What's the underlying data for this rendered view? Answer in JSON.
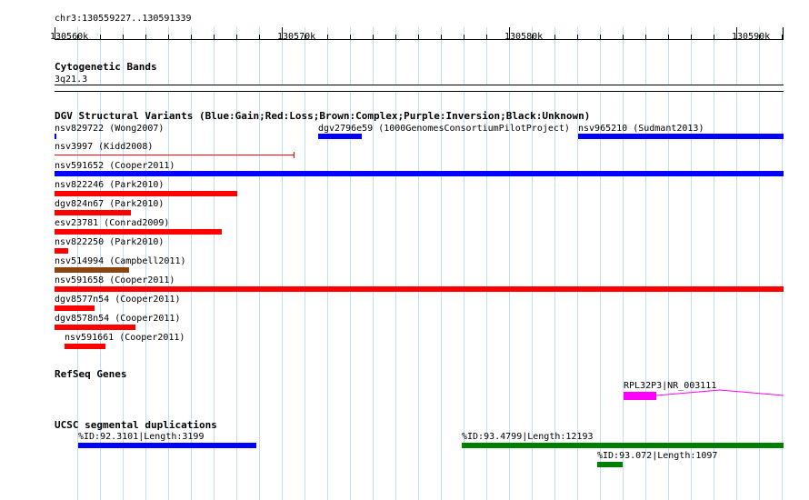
{
  "locus": "chr3:130559227..130591339",
  "ruler": {
    "labels": [
      "130560k",
      "130570k",
      "130580k",
      "130590k"
    ]
  },
  "tracks": {
    "cyto": {
      "title": "Cytogenetic Bands",
      "band": "3q21.3"
    },
    "dgv": {
      "title": "DGV Structural Variants (Blue:Gain;Red:Loss;Brown:Complex;Purple:Inversion;Black:Unknown)",
      "features": [
        {
          "label": "nsv829722 (Wong2007)",
          "type": "Gain",
          "color": "#0000ff"
        },
        {
          "label": "dgv2796e59 (1000GenomesConsortiumPilotProject)",
          "type": "Gain",
          "color": "#0000ff"
        },
        {
          "label": "nsv965210 (Sudmant2013)",
          "type": "Gain",
          "color": "#0000ff"
        },
        {
          "label": "nsv3997 (Kidd2008)",
          "type": "Loss",
          "color": "#ff0000"
        },
        {
          "label": "nsv591652 (Cooper2011)",
          "type": "Gain",
          "color": "#0000ff"
        },
        {
          "label": "nsv822246 (Park2010)",
          "type": "Loss",
          "color": "#ff0000"
        },
        {
          "label": "dgv824n67 (Park2010)",
          "type": "Loss",
          "color": "#ff0000"
        },
        {
          "label": "esv23781 (Conrad2009)",
          "type": "Loss",
          "color": "#ff0000"
        },
        {
          "label": "nsv822250 (Park2010)",
          "type": "Loss",
          "color": "#ff0000"
        },
        {
          "label": "nsv514994 (Campbell2011)",
          "type": "Complex",
          "color": "#8b4513"
        },
        {
          "label": "nsv591658 (Cooper2011)",
          "type": "Loss",
          "color": "#ff0000"
        },
        {
          "label": "dgv8577n54 (Cooper2011)",
          "type": "Loss",
          "color": "#ff0000"
        },
        {
          "label": "dgv8578n54 (Cooper2011)",
          "type": "Loss",
          "color": "#ff0000"
        },
        {
          "label": "nsv591661 (Cooper2011)",
          "type": "Loss",
          "color": "#ff0000"
        }
      ]
    },
    "refseq": {
      "title": "RefSeq Genes",
      "gene": "RPL32P3|NR_003111",
      "color": "#ff00ff"
    },
    "segdup": {
      "title": "UCSC segmental duplications",
      "features": [
        {
          "label": "%ID:92.3101|Length:3199",
          "color": "#0000ff"
        },
        {
          "label": "%ID:93.4799|Length:12193",
          "color": "#008000"
        },
        {
          "label": "%ID:93.072|Length:1097",
          "color": "#008000"
        }
      ]
    }
  }
}
